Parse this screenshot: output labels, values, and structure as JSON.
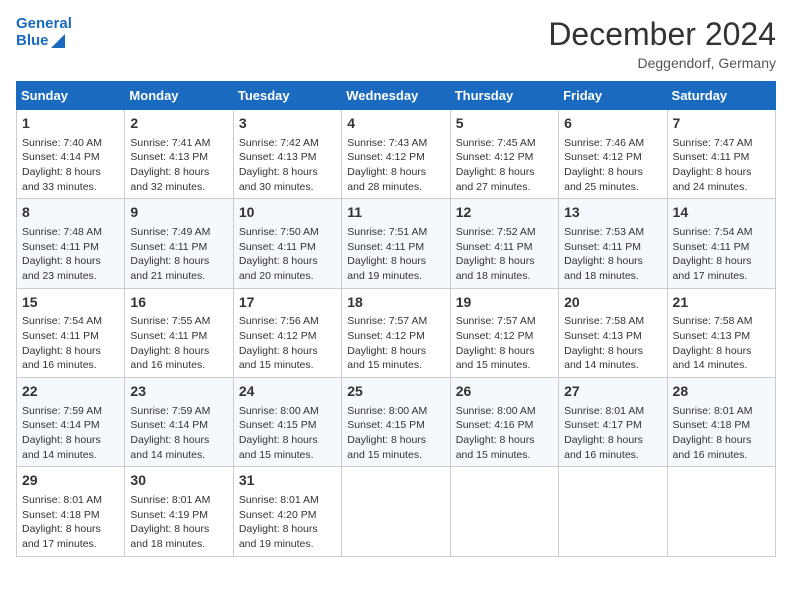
{
  "header": {
    "logo_line1": "General",
    "logo_line2": "Blue",
    "month_year": "December 2024",
    "location": "Deggendorf, Germany"
  },
  "days_of_week": [
    "Sunday",
    "Monday",
    "Tuesday",
    "Wednesday",
    "Thursday",
    "Friday",
    "Saturday"
  ],
  "weeks": [
    [
      {
        "day": 1,
        "info": "Sunrise: 7:40 AM\nSunset: 4:14 PM\nDaylight: 8 hours and 33 minutes."
      },
      {
        "day": 2,
        "info": "Sunrise: 7:41 AM\nSunset: 4:13 PM\nDaylight: 8 hours and 32 minutes."
      },
      {
        "day": 3,
        "info": "Sunrise: 7:42 AM\nSunset: 4:13 PM\nDaylight: 8 hours and 30 minutes."
      },
      {
        "day": 4,
        "info": "Sunrise: 7:43 AM\nSunset: 4:12 PM\nDaylight: 8 hours and 28 minutes."
      },
      {
        "day": 5,
        "info": "Sunrise: 7:45 AM\nSunset: 4:12 PM\nDaylight: 8 hours and 27 minutes."
      },
      {
        "day": 6,
        "info": "Sunrise: 7:46 AM\nSunset: 4:12 PM\nDaylight: 8 hours and 25 minutes."
      },
      {
        "day": 7,
        "info": "Sunrise: 7:47 AM\nSunset: 4:11 PM\nDaylight: 8 hours and 24 minutes."
      }
    ],
    [
      {
        "day": 8,
        "info": "Sunrise: 7:48 AM\nSunset: 4:11 PM\nDaylight: 8 hours and 23 minutes."
      },
      {
        "day": 9,
        "info": "Sunrise: 7:49 AM\nSunset: 4:11 PM\nDaylight: 8 hours and 21 minutes."
      },
      {
        "day": 10,
        "info": "Sunrise: 7:50 AM\nSunset: 4:11 PM\nDaylight: 8 hours and 20 minutes."
      },
      {
        "day": 11,
        "info": "Sunrise: 7:51 AM\nSunset: 4:11 PM\nDaylight: 8 hours and 19 minutes."
      },
      {
        "day": 12,
        "info": "Sunrise: 7:52 AM\nSunset: 4:11 PM\nDaylight: 8 hours and 18 minutes."
      },
      {
        "day": 13,
        "info": "Sunrise: 7:53 AM\nSunset: 4:11 PM\nDaylight: 8 hours and 18 minutes."
      },
      {
        "day": 14,
        "info": "Sunrise: 7:54 AM\nSunset: 4:11 PM\nDaylight: 8 hours and 17 minutes."
      }
    ],
    [
      {
        "day": 15,
        "info": "Sunrise: 7:54 AM\nSunset: 4:11 PM\nDaylight: 8 hours and 16 minutes."
      },
      {
        "day": 16,
        "info": "Sunrise: 7:55 AM\nSunset: 4:11 PM\nDaylight: 8 hours and 16 minutes."
      },
      {
        "day": 17,
        "info": "Sunrise: 7:56 AM\nSunset: 4:12 PM\nDaylight: 8 hours and 15 minutes."
      },
      {
        "day": 18,
        "info": "Sunrise: 7:57 AM\nSunset: 4:12 PM\nDaylight: 8 hours and 15 minutes."
      },
      {
        "day": 19,
        "info": "Sunrise: 7:57 AM\nSunset: 4:12 PM\nDaylight: 8 hours and 15 minutes."
      },
      {
        "day": 20,
        "info": "Sunrise: 7:58 AM\nSunset: 4:13 PM\nDaylight: 8 hours and 14 minutes."
      },
      {
        "day": 21,
        "info": "Sunrise: 7:58 AM\nSunset: 4:13 PM\nDaylight: 8 hours and 14 minutes."
      }
    ],
    [
      {
        "day": 22,
        "info": "Sunrise: 7:59 AM\nSunset: 4:14 PM\nDaylight: 8 hours and 14 minutes."
      },
      {
        "day": 23,
        "info": "Sunrise: 7:59 AM\nSunset: 4:14 PM\nDaylight: 8 hours and 14 minutes."
      },
      {
        "day": 24,
        "info": "Sunrise: 8:00 AM\nSunset: 4:15 PM\nDaylight: 8 hours and 15 minutes."
      },
      {
        "day": 25,
        "info": "Sunrise: 8:00 AM\nSunset: 4:15 PM\nDaylight: 8 hours and 15 minutes."
      },
      {
        "day": 26,
        "info": "Sunrise: 8:00 AM\nSunset: 4:16 PM\nDaylight: 8 hours and 15 minutes."
      },
      {
        "day": 27,
        "info": "Sunrise: 8:01 AM\nSunset: 4:17 PM\nDaylight: 8 hours and 16 minutes."
      },
      {
        "day": 28,
        "info": "Sunrise: 8:01 AM\nSunset: 4:18 PM\nDaylight: 8 hours and 16 minutes."
      }
    ],
    [
      {
        "day": 29,
        "info": "Sunrise: 8:01 AM\nSunset: 4:18 PM\nDaylight: 8 hours and 17 minutes."
      },
      {
        "day": 30,
        "info": "Sunrise: 8:01 AM\nSunset: 4:19 PM\nDaylight: 8 hours and 18 minutes."
      },
      {
        "day": 31,
        "info": "Sunrise: 8:01 AM\nSunset: 4:20 PM\nDaylight: 8 hours and 19 minutes."
      },
      null,
      null,
      null,
      null
    ]
  ]
}
